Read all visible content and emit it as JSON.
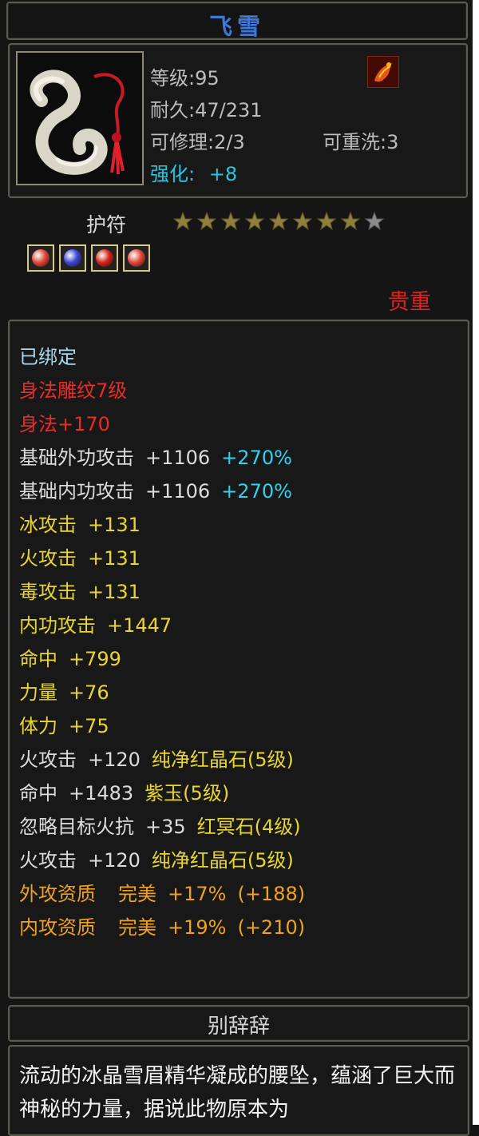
{
  "item": {
    "name": "飞雪",
    "level": "等级:95",
    "durability": "耐久:47/231",
    "repairable": "可修理:2/3",
    "rewash": "可重洗:3",
    "enhance_label": "强化:",
    "enhance_value": "+8",
    "type": "护符",
    "stars_total": 9,
    "stars_filled": 8,
    "rarity": "贵重",
    "sockets": [
      {
        "gem": "red-gem-icon",
        "color": "#e24a3a"
      },
      {
        "gem": "blue-gem-icon",
        "color": "#3a48d8"
      },
      {
        "gem": "red-gem-icon",
        "color": "#d42618"
      },
      {
        "gem": "red-gem-icon",
        "color": "#e24a3a"
      }
    ]
  },
  "attributes": {
    "bound": "已绑定",
    "engrave": "身法雕纹7级",
    "agility": "身法+170",
    "ext_atk_label": "基础外功攻击",
    "ext_atk_value": "+1106",
    "ext_atk_pct": "+270%",
    "int_atk_label": "基础内功攻击",
    "int_atk_value": "+1106",
    "int_atk_pct": "+270%",
    "ice_label": "冰攻击",
    "ice_value": "+131",
    "fire_label": "火攻击",
    "fire_value": "+131",
    "poison_label": "毒攻击",
    "poison_value": "+131",
    "inner_label": "内功攻击",
    "inner_value": "+1447",
    "hit_label": "命中",
    "hit_value": "+799",
    "str_label": "力量",
    "str_value": "+76",
    "sta_label": "体力",
    "sta_value": "+75",
    "gem1_label": "火攻击",
    "gem1_value": "+120",
    "gem1_name": "纯净红晶石(5级)",
    "gem2_label": "命中",
    "gem2_value": "+1483",
    "gem2_name": "紫玉(5级)",
    "gem3_label": "忽略目标火抗",
    "gem3_value": "+35",
    "gem3_name": "红冥石(4级)",
    "gem4_label": "火攻击",
    "gem4_value": "+120",
    "gem4_name": "纯净红晶石(5级)",
    "q1_label": "外攻资质",
    "q1_grade": "完美",
    "q1_pct": "+17%",
    "q1_bonus": "(+188)",
    "q2_label": "内攻资质",
    "q2_grade": "完美",
    "q2_pct": "+19%",
    "q2_bonus": "(+210)"
  },
  "lore": {
    "title": "别辞辞",
    "text": "流动的冰晶雪眉精华凝成的腰坠，蕴涵了巨大而神秘的力量，据说此物原本为"
  }
}
